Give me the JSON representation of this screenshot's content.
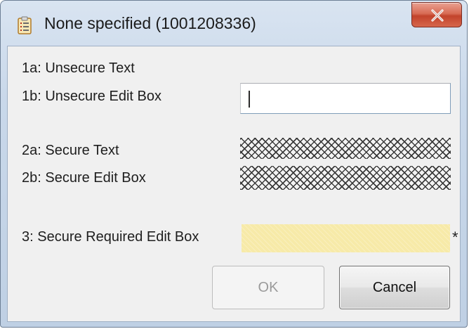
{
  "window": {
    "title": "None specified (1001208336)",
    "icon": "clipboard-icon",
    "close_icon": "close-icon",
    "close_label": "X"
  },
  "form": {
    "label_1a": "1a: Unsecure Text",
    "label_1b": "1b: Unsecure Edit Box",
    "unsecure_edit_value": "",
    "label_2a": "2a: Secure Text",
    "label_2b": "2b: Secure Edit Box",
    "label_3": "3: Secure Required Edit Box",
    "required_marker": "*"
  },
  "buttons": {
    "ok": "OK",
    "cancel": "Cancel"
  },
  "colors": {
    "required_field": "#f7eaa8",
    "close_button": "#c9452d"
  }
}
